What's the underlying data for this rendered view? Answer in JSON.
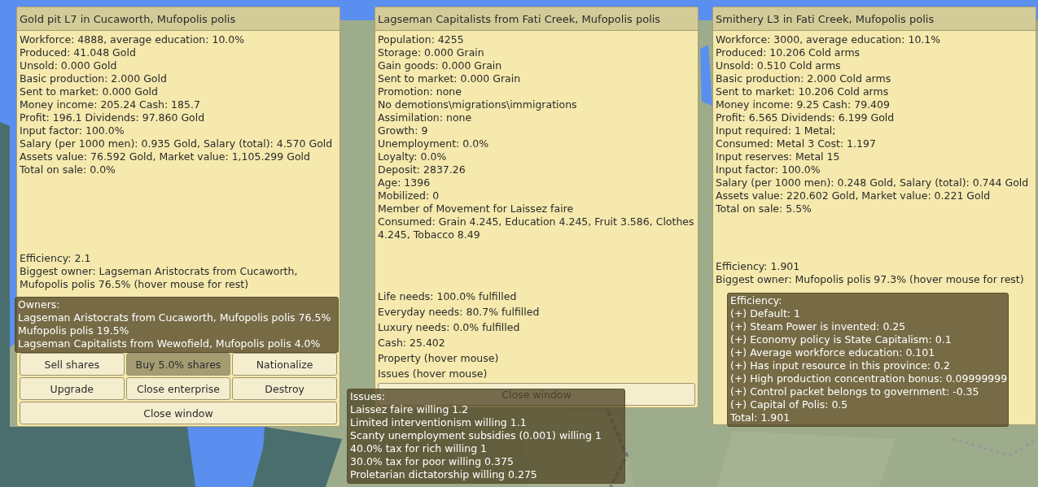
{
  "windows": [
    {
      "kind": "enterprise",
      "title": "Gold pit L7 in Cucaworth, Mufopolis polis",
      "lines": [
        "Workforce: 4888, average education: 10.0%",
        "Produced: 41.048 Gold",
        "Unsold: 0.000 Gold",
        "Basic production: 2.000 Gold",
        "Sent to market: 0.000 Gold",
        "Money income: 205.24 Cash: 185.7",
        "Profit: 196.1 Dividends: 97.860 Gold",
        "Input factor: 100.0%",
        "Salary (per 1000 men): 0.935 Gold, Salary (total): 4.570 Gold",
        "Assets value: 76.592 Gold, Market value: 1,105.299 Gold",
        "Total on sale: 0.0%"
      ],
      "efficiency": "Efficiency: 2.1",
      "biggest_owner": "Biggest owner: Lagseman Aristocrats from Cucaworth, Mufopolis polis 76.5% (hover mouse for rest)",
      "buttons": [
        {
          "label": "Sell shares",
          "selected": false
        },
        {
          "label": "Buy 5.0% shares",
          "selected": true
        },
        {
          "label": "Nationalize",
          "selected": false
        },
        {
          "label": "Upgrade",
          "selected": false
        },
        {
          "label": "Close enterprise",
          "selected": false
        },
        {
          "label": "Destroy",
          "selected": false
        }
      ],
      "close": "Close window",
      "tooltip": [
        "Owners:",
        "Lagseman Aristocrats from Cucaworth, Mufopolis polis 76.5%",
        "Mufopolis polis 19.5%",
        "Lagseman Capitalists from Wewofield, Mufopolis polis 4.0%"
      ]
    },
    {
      "kind": "population",
      "title": "Lagseman Capitalists from Fati Creek, Mufopolis polis",
      "lines": [
        "Population: 4255",
        "Storage: 0.000 Grain",
        "Gain goods: 0.000 Grain",
        "Sent to market: 0.000 Grain",
        "Promotion: none",
        "No demotions\\migrations\\immigrations",
        "Assimilation: none",
        "Growth: 9",
        "Unemployment: 0.0%",
        "Loyalty: 0.0%",
        "Deposit: 2837.26",
        "Age: 1396",
        "Mobilized: 0",
        "Member of Movement for Laissez faire",
        "Consumed: Grain 4.245, Education 4.245, Fruit 3.586, Clothes 4.245, Tobacco 8.49"
      ],
      "needs": [
        "Life needs: 100.0% fulfilled",
        "Everyday needs: 80.7% fulfilled",
        "Luxury needs: 0.0% fulfilled",
        "Cash: 25.402",
        "Property (hover mouse)",
        "Issues (hover mouse)"
      ],
      "close": "Close window",
      "tooltip": [
        "Issues:",
        "Laissez faire willing 1.2",
        "Limited interventionism willing 1.1",
        "Scanty unemployment subsidies (0.001) willing 1",
        "40.0% tax for rich willing 1",
        "30.0% tax for poor willing 0.375",
        "Proletarian dictatorship willing 0.275"
      ]
    },
    {
      "kind": "enterprise",
      "title": "Smithery L3 in Fati Creek, Mufopolis polis",
      "lines": [
        "Workforce: 3000, average education: 10.1%",
        "Produced: 10.206 Cold arms",
        "Unsold: 0.510 Cold arms",
        "Basic production: 2.000 Cold arms",
        "Sent to market: 10.206 Cold arms",
        "Money income: 9.25 Cash: 79.409",
        "Profit: 6.565 Dividends: 6.199 Gold",
        "Input required: 1 Metal;",
        "Consumed: Metal 3 Cost: 1.197",
        "Input reserves: Metal 15",
        "Input factor: 100.0%",
        "Salary (per 1000 men): 0.248 Gold, Salary (total): 0.744 Gold",
        "Assets value: 220.602 Gold, Market value: 0.221 Gold",
        "Total on sale: 5.5%"
      ],
      "efficiency": "Efficiency: 1.901",
      "biggest_owner": "Biggest owner: Mufopolis polis 97.3% (hover mouse for rest)",
      "tooltip": [
        "Efficiency:",
        "(+) Default: 1",
        "(+) Steam Power is invented: 0.25",
        "(+) Economy policy is State Capitalism: 0.1",
        "(+) Average workforce education: 0.101",
        "(+) Has input resource in this province: 0.2",
        "(+) High production concentration bonus: 0.09999999",
        "(+) Control packet belongs to government: -0.35",
        "(+) Capital of Polis: 0.5",
        "Total: 1.901"
      ]
    }
  ]
}
